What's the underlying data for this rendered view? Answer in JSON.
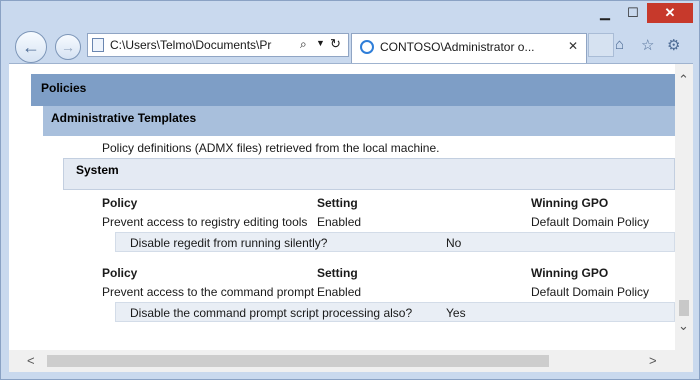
{
  "window": {
    "minimize_glyph": "▁",
    "maximize_glyph": "☐",
    "close_glyph": "✕"
  },
  "nav": {
    "back_glyph": "←",
    "forward_glyph": "→",
    "address": "C:\\Users\\Telmo\\Documents\\Pr",
    "search_glyph": "⌕",
    "dropdown_glyph": "▼",
    "refresh_glyph": "↻"
  },
  "tab": {
    "title": "CONTOSO\\Administrator o...",
    "close_glyph": "✕"
  },
  "toolbar": {
    "home_glyph": "⌂",
    "favorites_glyph": "☆",
    "settings_glyph": "⚙"
  },
  "report": {
    "policies_heading": "Policies",
    "admin_templates_heading": "Administrative Templates",
    "admx_note": "Policy definitions (ADMX files) retrieved from the local machine.",
    "system_heading": "System",
    "tables": [
      {
        "headers": {
          "policy": "Policy",
          "setting": "Setting",
          "gpo": "Winning GPO"
        },
        "row": {
          "policy": "Prevent access to registry editing tools",
          "setting": "Enabled",
          "gpo": "Default Domain Policy"
        },
        "sub": {
          "question": "Disable regedit from running silently?",
          "answer": "No"
        }
      },
      {
        "headers": {
          "policy": "Policy",
          "setting": "Setting",
          "gpo": "Winning GPO"
        },
        "row": {
          "policy": "Prevent access to the command prompt",
          "setting": "Enabled",
          "gpo": "Default Domain Policy"
        },
        "sub": {
          "question": "Disable the command prompt script processing also?",
          "answer": "Yes"
        }
      }
    ]
  },
  "scrollbars": {
    "up_glyph": "⌃",
    "down_glyph": "⌄",
    "left_glyph": "<",
    "right_glyph": ">"
  },
  "colors": {
    "policies_bar": "#7e9ec6",
    "admin_bar": "#a8bfdc",
    "system_bar": "#e4eaf3",
    "close_button": "#c7392b"
  }
}
